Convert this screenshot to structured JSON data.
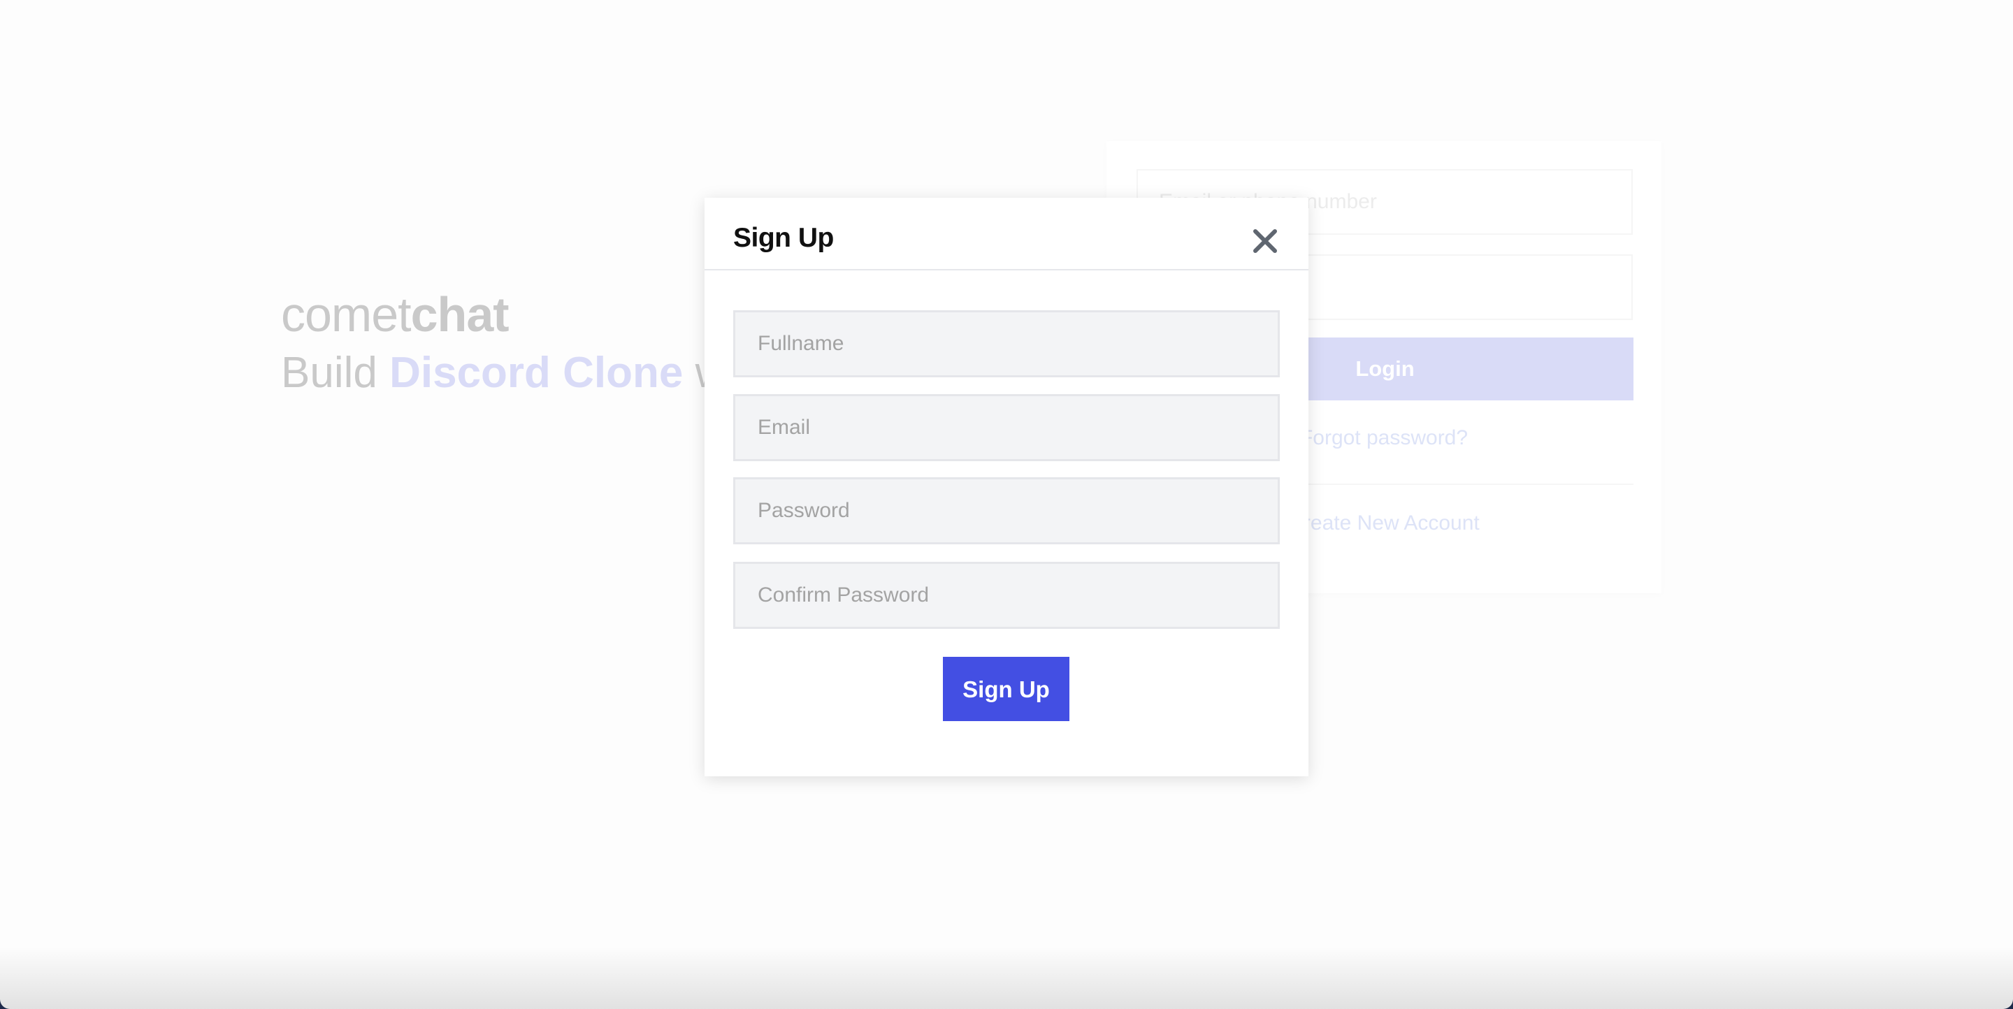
{
  "background_page": {
    "brand": {
      "light": "comet",
      "bold": "chat"
    },
    "tagline": {
      "prefix": "Build ",
      "accent": "Discord Clone",
      "suffix": " w"
    },
    "login_card": {
      "email_placeholder": "Email or phone number",
      "password_placeholder": "",
      "login_label": "Login",
      "forgot_password_label": "Forgot password?",
      "create_account_label": "Create New Account"
    }
  },
  "signup_modal": {
    "title": "Sign Up",
    "close_icon": "close-icon",
    "fields": [
      {
        "name": "fullname",
        "placeholder": "Fullname",
        "value": ""
      },
      {
        "name": "email",
        "placeholder": "Email",
        "value": ""
      },
      {
        "name": "password",
        "placeholder": "Password",
        "value": ""
      },
      {
        "name": "confirm_password",
        "placeholder": "Confirm Password",
        "value": ""
      }
    ],
    "submit_label": "Sign Up"
  },
  "colors": {
    "primary": "#434fe3",
    "primary_dimmed": "#d9dbf7",
    "input_bg": "#f3f4f6",
    "input_border": "#e5e6ea",
    "placeholder": "#a3a3a3",
    "brand_text": "#c9c9c9"
  }
}
